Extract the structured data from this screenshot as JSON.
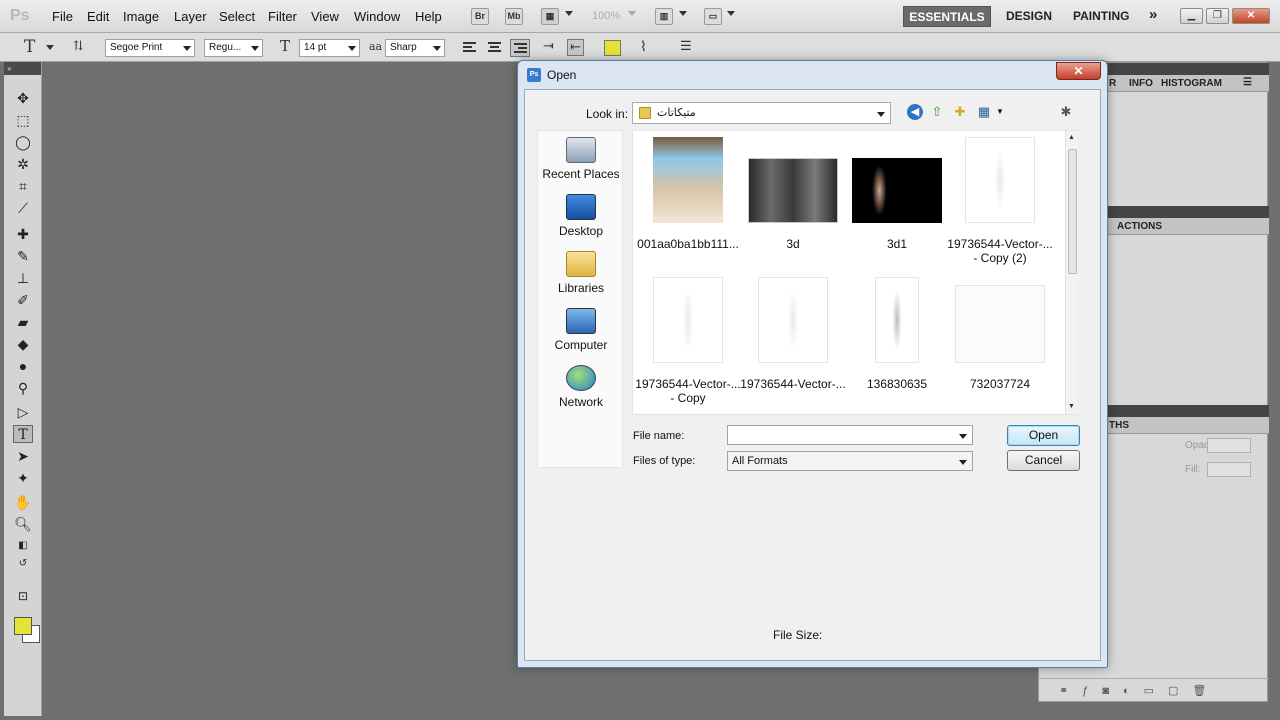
{
  "app": {
    "logo": "Ps",
    "menu": [
      "File",
      "Edit",
      "Image",
      "Layer",
      "Select",
      "Filter",
      "View",
      "Window",
      "Help"
    ],
    "bridge_btn": "Br",
    "minibridge_btn": "Mb",
    "zoom": "100%",
    "workspaces": [
      "ESSENTIALS",
      "DESIGN",
      "PAINTING"
    ],
    "more_workspaces": "»"
  },
  "options_bar": {
    "font_family": "Segoe Print",
    "font_style": "Regu...",
    "font_size": "14 pt",
    "antialias_label": "aa",
    "antialias": "Sharp",
    "text_color": "#e3e536"
  },
  "toolbar": {
    "header": "»",
    "foreground_color": "#e3e536",
    "background_color": "#ffffff"
  },
  "panels": {
    "top_tabs": [
      "R",
      "INFO",
      "HISTOGRAM"
    ],
    "mid_tabs": [
      "ACTIONS"
    ],
    "bottom_tabs": [
      "THS"
    ],
    "opacity_label": "Opacity:",
    "fill_label": "Fill:"
  },
  "dialog": {
    "title": "Open",
    "icon_text": "Ps",
    "close": "✕",
    "look_in_label": "Look in:",
    "look_in_value": "متيكاتات",
    "places": [
      "Recent Places",
      "Desktop",
      "Libraries",
      "Computer",
      "Network"
    ],
    "files": [
      {
        "name": "001aa0ba1bb111..."
      },
      {
        "name": "3d"
      },
      {
        "name": "3d1"
      },
      {
        "name": "19736544-Vector-... - Copy (2)"
      },
      {
        "name": "19736544-Vector-... - Copy"
      },
      {
        "name": "19736544-Vector-..."
      },
      {
        "name": "136830635"
      },
      {
        "name": "732037724"
      }
    ],
    "file_name_label": "File name:",
    "file_name_value": "",
    "file_type_label": "Files of type:",
    "file_type_value": "All Formats",
    "open_btn": "Open",
    "cancel_btn": "Cancel",
    "file_size_label": "File Size:"
  }
}
